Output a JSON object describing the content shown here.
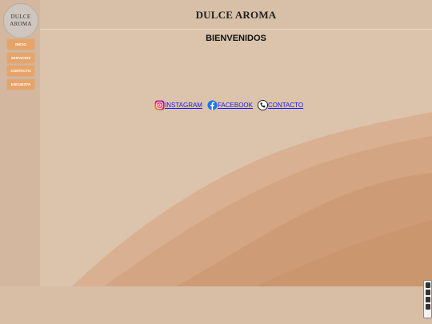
{
  "logo": {
    "line1": "DULCE",
    "line2": "AROMA"
  },
  "nav": [
    {
      "label": "INICIO"
    },
    {
      "label": "SERVICIOS"
    },
    {
      "label": "CONTACTO"
    },
    {
      "label": "ENCUESTA"
    }
  ],
  "header": {
    "brand": "DULCE AROMA"
  },
  "main": {
    "welcome": "BIENVENIDOS"
  },
  "social": {
    "instagram": "INSTAGRAM",
    "facebook": "FACEBOOK",
    "contact": "CONTACTO"
  },
  "colors": {
    "nav_bg": "#e8a468",
    "link": "#1a1aee",
    "background": "#d7bfa6"
  }
}
